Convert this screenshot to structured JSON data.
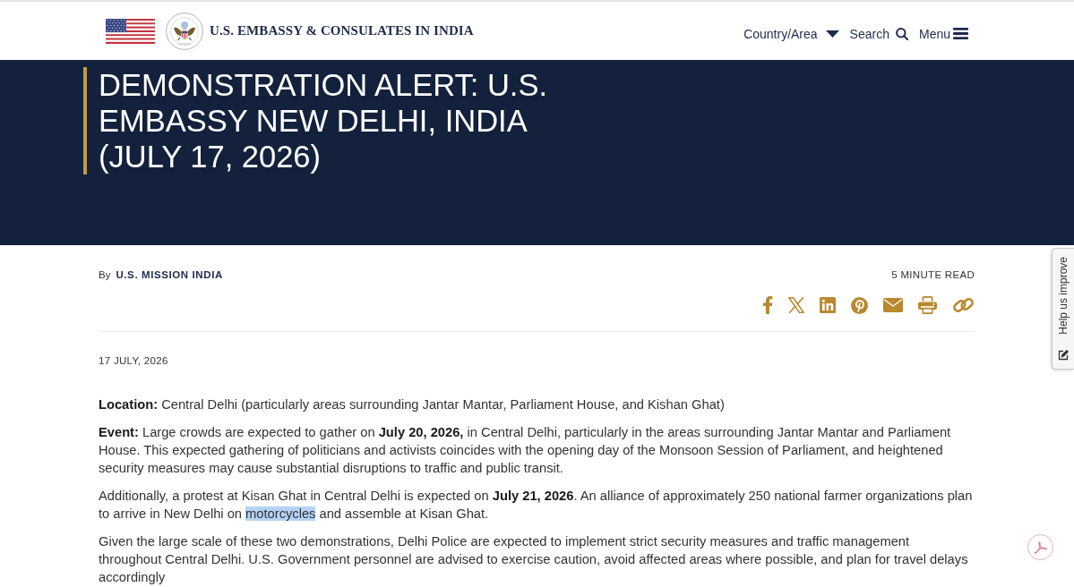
{
  "header": {
    "site_title": "U.S. EMBASSY & CONSULATES IN INDIA",
    "nav": [
      {
        "label": "Country/Area",
        "kind": "dropdown"
      },
      {
        "label": "Search",
        "kind": "search"
      },
      {
        "label": "Menu",
        "kind": "menu"
      }
    ]
  },
  "banner": {
    "title": "DEMONSTRATION ALERT: U.S. EMBASSY NEW DELHI, INDIA (JULY 17, 2026)"
  },
  "article": {
    "byline": {
      "prefix": "By",
      "author": "U.S. MISSION INDIA"
    },
    "read_time": "5 MINUTE READ",
    "date": "17 JULY, 2026",
    "paragraphs": [
      {
        "runs": [
          {
            "text": "**Location:** Central Delhi (particularly areas surrounding Jantar Mantar, Parliament House, and Kishan Ghat)",
            "selected": false
          }
        ]
      },
      {
        "runs": [
          {
            "text": "**Event:** Large crowds are expected to gather on **July 20, 2026,** in Central Delhi, particularly in the areas surrounding Jantar Mantar and Parliament House. This expected gathering of politicians and activists coincides with the opening day of the Monsoon Session of Parliament, and heightened security measures may cause substantial disruptions to traffic and public transit.",
            "selected": false
          }
        ]
      },
      {
        "runs": [
          {
            "text": "Additionally, a protest at Kisan Ghat in Central Delhi is expected on **July 21, 2026**. An alliance of approximately 250 national farmer organizations plan to arrive in New Delhi on ",
            "selected": false
          },
          {
            "text": "motorcycles",
            "selected": true
          },
          {
            "text": " and assemble at Kisan Ghat.",
            "selected": false
          }
        ]
      },
      {
        "runs": [
          {
            "text": "Given the large scale of these two demonstrations, Delhi Police are expected to implement strict security measures and traffic management throughout Central Delhi. U.S. Government personnel are advised to exercise caution, avoid affected areas where possible, and plan for travel delays accordingly",
            "selected": false
          }
        ]
      }
    ]
  },
  "feedback_tab": {
    "label": "Help us improve"
  }
}
